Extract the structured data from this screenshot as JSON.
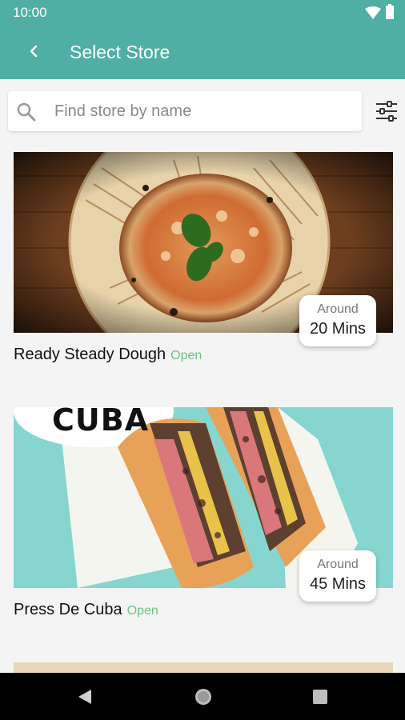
{
  "status_bar": {
    "time": "10:00"
  },
  "app_bar": {
    "title": "Select Store"
  },
  "search": {
    "placeholder": "Find store by name",
    "value": ""
  },
  "stores": [
    {
      "name": "Ready Steady Dough",
      "status": "Open",
      "eta_label": "Around",
      "eta_value": "20 Mins"
    },
    {
      "name": "Press De Cuba",
      "status": "Open",
      "eta_label": "Around",
      "eta_value": "45 Mins",
      "image_text": "CUBA"
    }
  ],
  "colors": {
    "accent": "#4fafa4",
    "open_status": "#6cc488"
  },
  "icons": {
    "back": "back-arrow-icon",
    "search": "search-icon",
    "filter": "filter-sliders-icon",
    "nav_back": "nav-back-icon",
    "nav_home": "nav-home-icon",
    "nav_recents": "nav-recents-icon"
  }
}
